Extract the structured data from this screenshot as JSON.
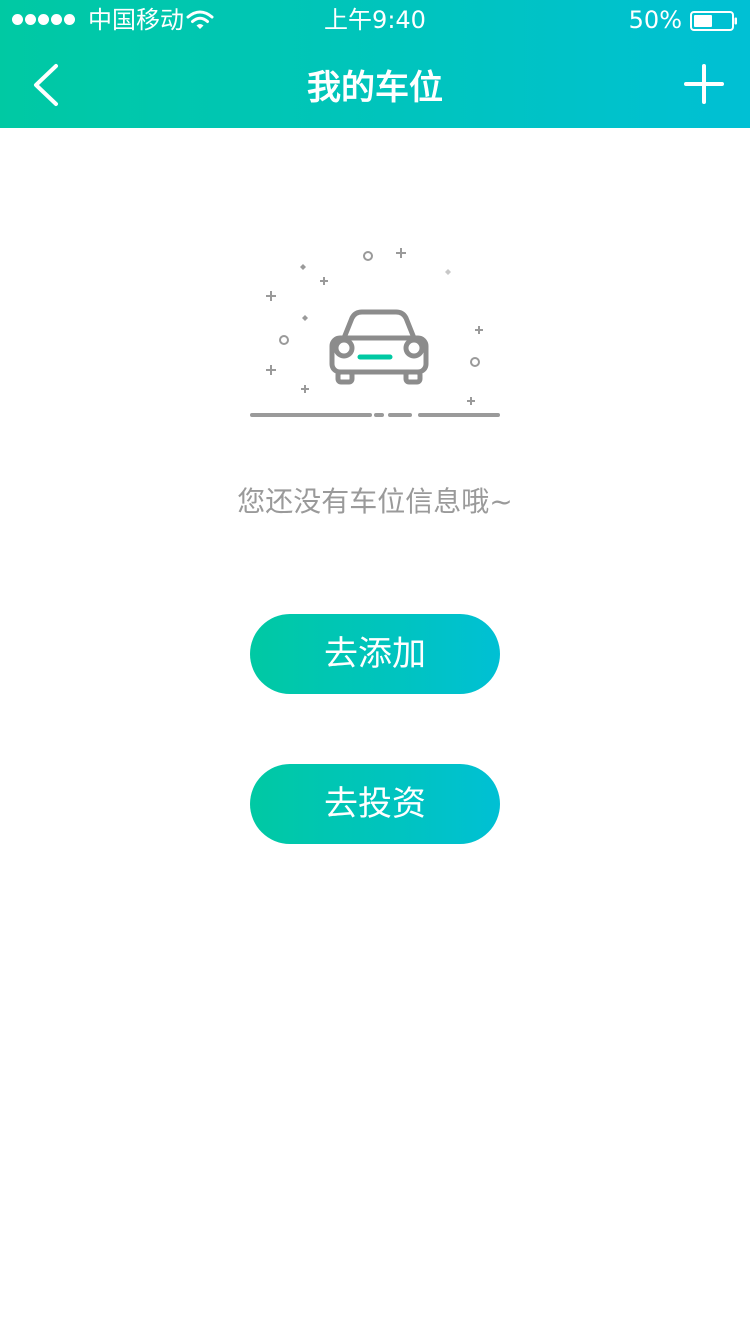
{
  "status_bar": {
    "carrier": "中国移动",
    "time": "上午9:40",
    "battery": "50%",
    "battery_level": 0.5,
    "signal_bars": 5
  },
  "nav": {
    "title": "我的车位",
    "back_icon": "chevron-left-icon",
    "add_icon": "plus-icon"
  },
  "empty_state": {
    "message": "您还没有车位信息哦~",
    "illustration_icon": "car-icon"
  },
  "actions": {
    "add_label": "去添加",
    "invest_label": "去投资"
  },
  "colors": {
    "gradient_start": "#00c9a3",
    "gradient_end": "#00c0d4",
    "muted_text": "#9a9a9a",
    "illustration_gray": "#8c8c8c"
  }
}
